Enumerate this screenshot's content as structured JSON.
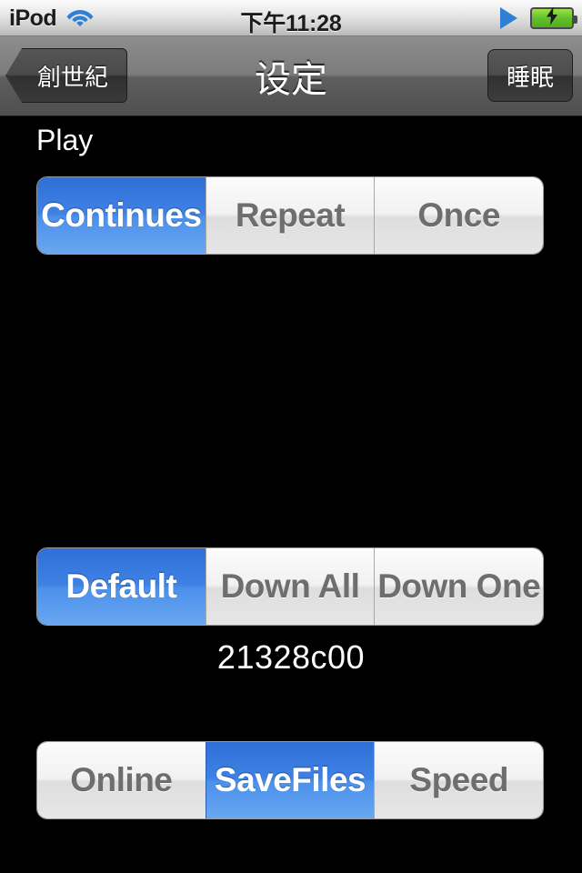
{
  "status_bar": {
    "carrier": "iPod",
    "wifi_icon": "wifi-icon",
    "time": "下午11:28",
    "play_icon": "play-triangle-icon",
    "battery_icon": "battery-charging-icon"
  },
  "nav_bar": {
    "back_label": "創世紀",
    "title": "设定",
    "right_label": "睡眠"
  },
  "main": {
    "play_section_label": "Play",
    "play_segments": [
      {
        "label": "Continues",
        "selected": true
      },
      {
        "label": "Repeat",
        "selected": false
      },
      {
        "label": "Once",
        "selected": false
      }
    ],
    "download_segments": [
      {
        "label": "Default",
        "selected": true
      },
      {
        "label": "Down All",
        "selected": false
      },
      {
        "label": "Down One",
        "selected": false
      }
    ],
    "hash_value": "21328c00",
    "mode_segments": [
      {
        "label": "Online",
        "selected": false
      },
      {
        "label": "SaveFiles",
        "selected": true
      },
      {
        "label": "Speed",
        "selected": false
      }
    ]
  },
  "colors": {
    "selected_blue": "#4b90ec",
    "background": "#000000",
    "segment_text": "#6e6e6e",
    "nav_bar": "#5e5e5e"
  }
}
